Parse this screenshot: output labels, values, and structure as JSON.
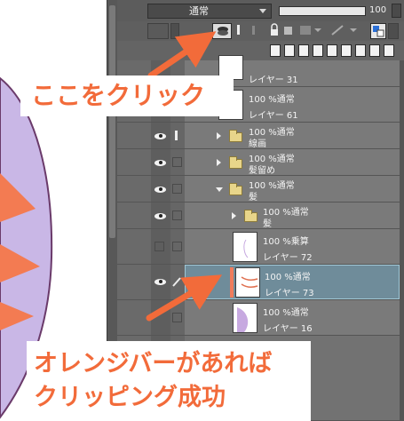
{
  "layer_palette": {
    "blend_mode": "通常",
    "opacity_value": "100",
    "opacity_fraction": 1.0
  },
  "layers": [
    {
      "id": "l31",
      "opacity": "",
      "name": "レイヤー 31",
      "kind": "layer",
      "visible": false
    },
    {
      "id": "l61",
      "opacity": "100 %通常",
      "name": "レイヤー 61",
      "kind": "layer",
      "visible": true
    },
    {
      "id": "senga",
      "opacity": "100 %通常",
      "name": "線画",
      "kind": "folder",
      "visible": true
    },
    {
      "id": "kamidome",
      "opacity": "100 %通常",
      "name": "髪留め",
      "kind": "folder",
      "visible": true
    },
    {
      "id": "kami",
      "opacity": "100 %通常",
      "name": "髪",
      "kind": "folder-open",
      "visible": true
    },
    {
      "id": "kami2",
      "opacity": "100 %通常",
      "name": "髪",
      "kind": "folder",
      "visible": true
    },
    {
      "id": "l72",
      "opacity": "100 %乗算",
      "name": "レイヤー 72",
      "kind": "layer",
      "visible": false
    },
    {
      "id": "l73",
      "opacity": "100 %通常",
      "name": "レイヤー 73",
      "kind": "layer",
      "visible": true,
      "selected": true,
      "clipped": true
    },
    {
      "id": "l16",
      "opacity": "100 %通常",
      "name": "レイヤー 16",
      "kind": "layer",
      "visible": false
    }
  ],
  "annotations": {
    "top_callout": "ここをクリック",
    "bottom_callout_line1": "オレンジバーがあれば",
    "bottom_callout_line2": "クリッピング成功",
    "accent_color": "#f26b3a",
    "arrow_color": "#f26b3a"
  },
  "icons": {
    "clip_toggle": "clipping-icon",
    "ref_layer": "reference-layer-icon",
    "lock": "lock-icon",
    "new_layer": "new-layer-icon",
    "trash": "trash-icon"
  }
}
